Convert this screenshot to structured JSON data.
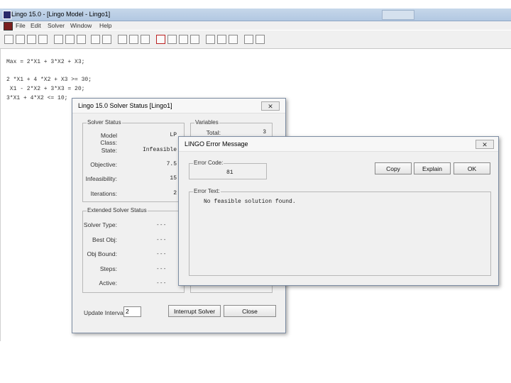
{
  "main_window": {
    "title": "Lingo 15.0 - [Lingo Model - Lingo1]",
    "menu": [
      "File",
      "Edit",
      "Solver",
      "Window",
      "Help"
    ]
  },
  "editor": {
    "lines": [
      "Max = 2*X1 + 3*X2 + X3;",
      "",
      "2 *X1 + 4 *X2 + X3 >= 30;",
      " X1 - 2*X2 + 3*X3 = 20;",
      "3*X1 + 4*X2 <= 10;"
    ]
  },
  "solver_status": {
    "title": "Lingo 15.0 Solver Status [Lingo1]",
    "close_glyph": "✕",
    "solver_group_label": "Solver Status",
    "model_class_label": "Model Class:",
    "model_class_value": "LP",
    "state_label": "State:",
    "state_value": "Infeasible",
    "objective_label": "Objective:",
    "objective_value": "7.5",
    "infeasibility_label": "Infeasibility:",
    "infeasibility_value": "15",
    "iterations_label": "Iterations:",
    "iterations_value": "2",
    "variables_group_label": "Variables",
    "total_label": "Total:",
    "total_value": "3",
    "extended_group_label": "Extended Solver Status",
    "solver_type_label": "Solver Type:",
    "best_obj_label": "Best Obj:",
    "obj_bound_label": "Obj Bound:",
    "steps_label": "Steps:",
    "active_label": "Active:",
    "empty_value": "- - -",
    "update_interval_label": "Update Interval:",
    "update_interval_value": "2",
    "interrupt_button": "Interrupt Solver",
    "close_button": "Close"
  },
  "error_dialog": {
    "title": "LINGO Error Message",
    "close_glyph": "✕",
    "error_code_label": "Error Code:",
    "error_code_value": "81",
    "copy_button": "Copy",
    "explain_button": "Explain",
    "ok_button": "OK",
    "error_text_label": "Error Text:",
    "error_text_value": "No feasible solution found."
  }
}
